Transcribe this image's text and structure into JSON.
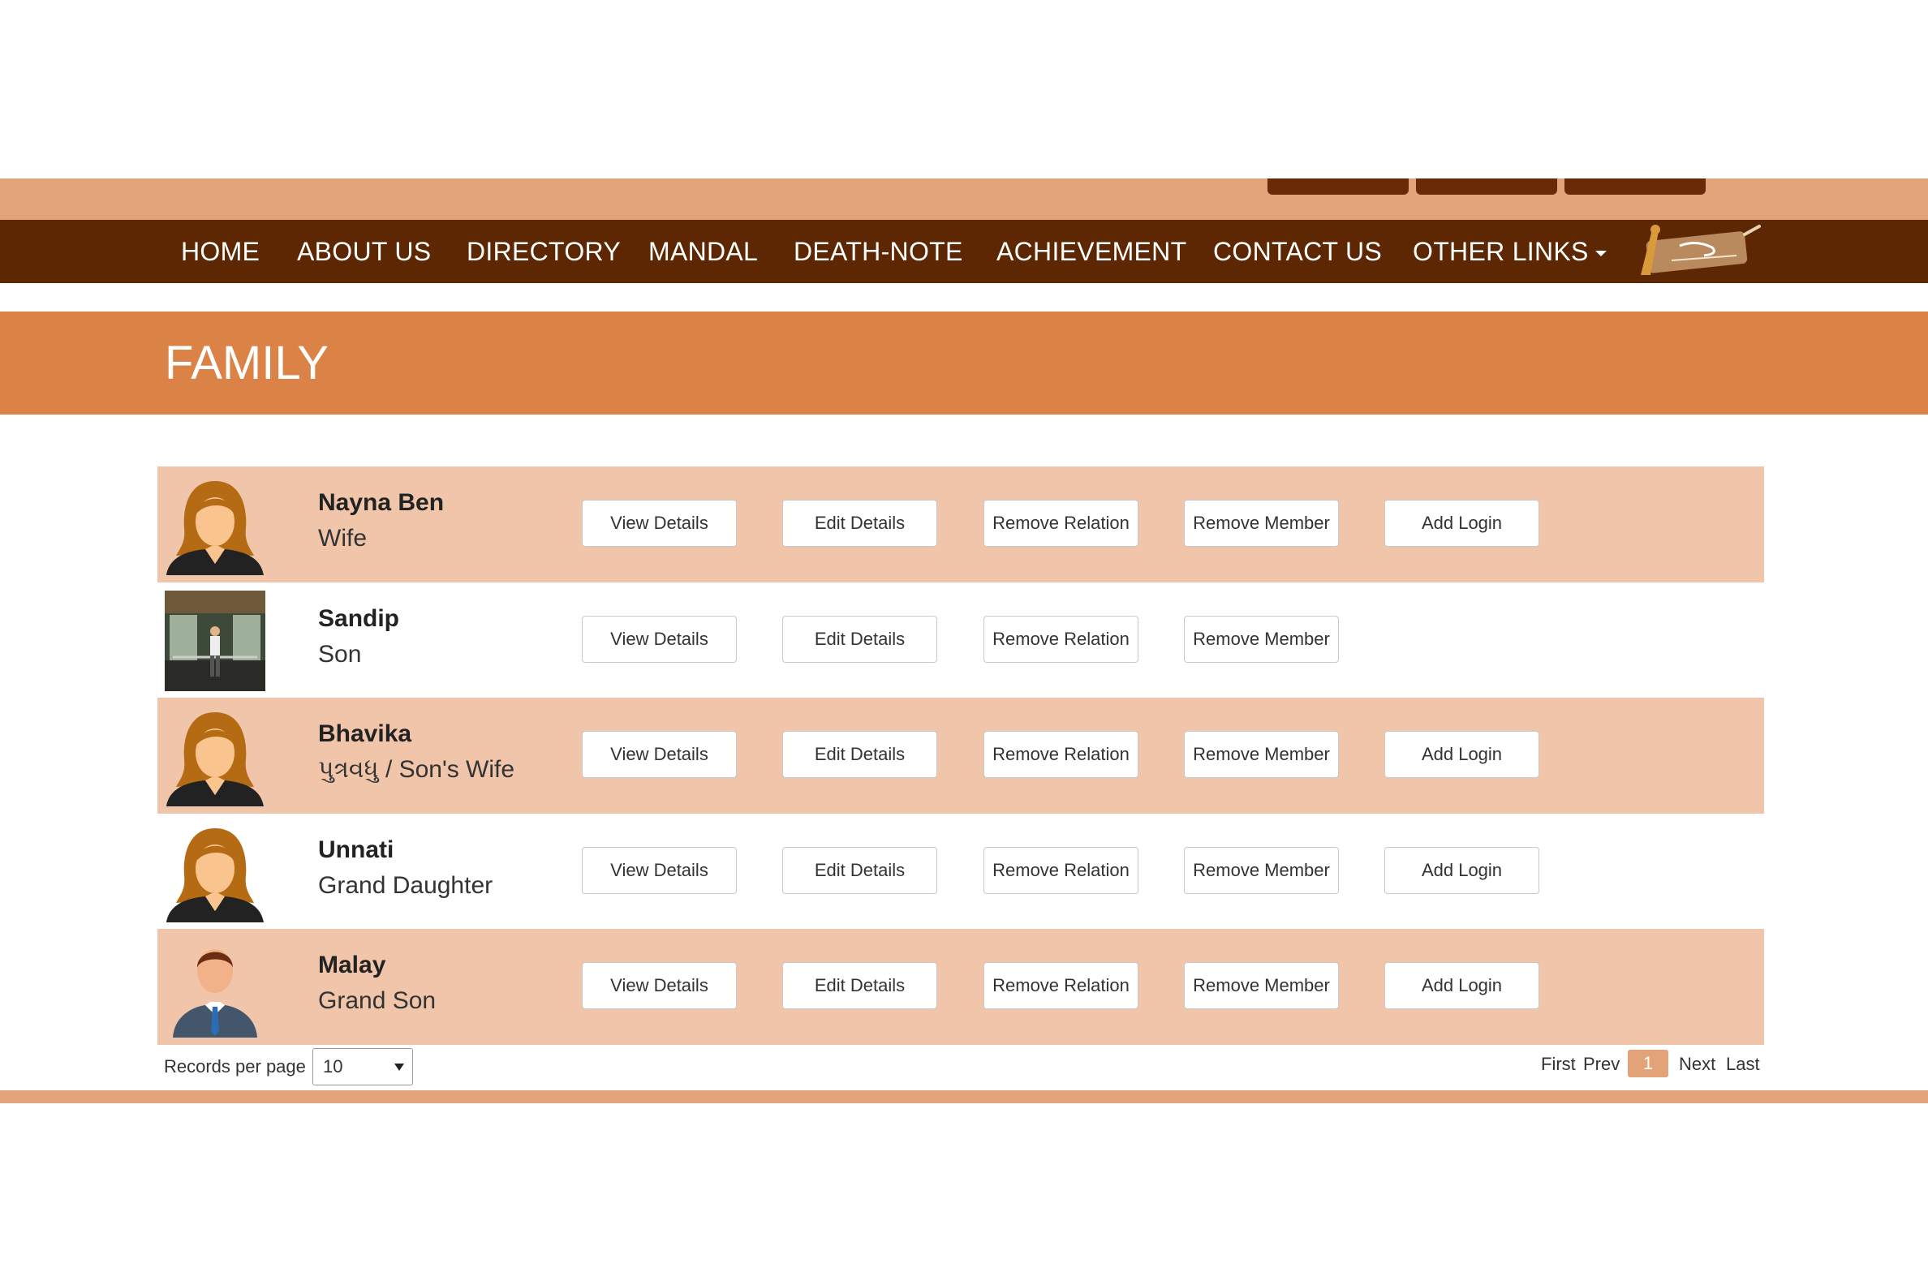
{
  "nav": {
    "items": [
      {
        "label": "HOME"
      },
      {
        "label": "ABOUT US"
      },
      {
        "label": "DIRECTORY"
      },
      {
        "label": "MANDAL"
      },
      {
        "label": "DEATH-NOTE"
      },
      {
        "label": "ACHIEVEMENT"
      },
      {
        "label": "CONTACT US"
      },
      {
        "label": "OTHER LINKS"
      }
    ]
  },
  "page": {
    "title": "FAMILY"
  },
  "members": [
    {
      "name": "Nayna Ben",
      "relation": "Wife"
    },
    {
      "name": "Sandip",
      "relation": "Son"
    },
    {
      "name": "Bhavika",
      "relation": "પુત્રવધુ / Son's Wife"
    },
    {
      "name": "Unnati",
      "relation": "Grand Daughter"
    },
    {
      "name": "Malay",
      "relation": "Grand Son"
    }
  ],
  "buttons": {
    "view": "View Details",
    "edit": "Edit Details",
    "remove_relation": "Remove Relation",
    "remove_member": "Remove Member",
    "add_login": "Add Login"
  },
  "pagination": {
    "records_label": "Records per page :",
    "per_page": "10",
    "first": "First",
    "prev": "Prev",
    "current": "1",
    "next": "Next",
    "last": "Last"
  },
  "colors": {
    "nav_bg": "#5e2703",
    "top_bar": "#e3a378",
    "family_band": "#db8246",
    "row_shade": "#f0c5aa"
  }
}
